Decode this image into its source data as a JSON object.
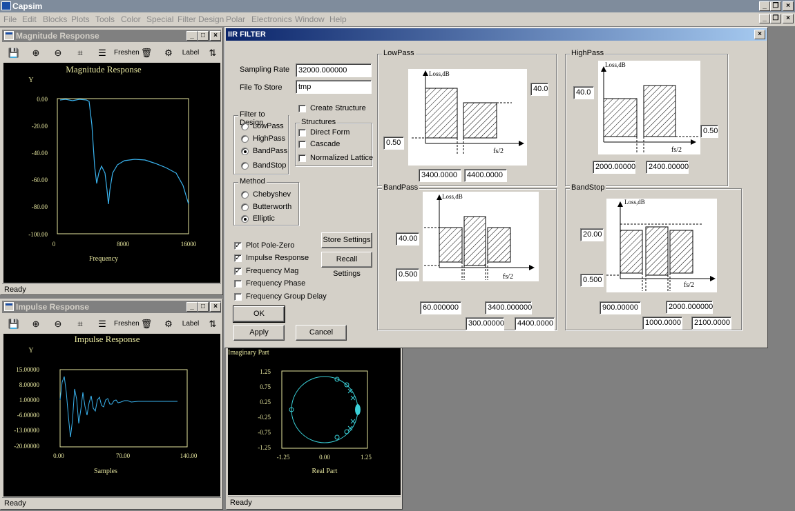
{
  "app": {
    "title": "Capsim"
  },
  "menu": [
    "File",
    "Edit",
    "Blocks",
    "Plots",
    "Tools",
    "Color",
    "Special",
    "Filter Design",
    "Polar",
    "Electronics",
    "Window",
    "Help"
  ],
  "toolbar": {
    "label_btn": "Label",
    "freshen": "Freshen"
  },
  "mag_window": {
    "title": "Magnitude Response",
    "plot_title": "Magnitude Response",
    "ylabel": "Y",
    "xlabel": "Frequency",
    "status": "Ready",
    "yticks": [
      "0.00",
      "-20.00",
      "-40.00",
      "-60.00",
      "-80.00",
      "-100.00"
    ],
    "xticks": [
      "0",
      "8000",
      "16000"
    ]
  },
  "imp_window": {
    "title": "Impulse Response",
    "plot_title": "Impulse Response",
    "ylabel": "Y",
    "xlabel": "Samples",
    "status": "Ready",
    "yticks": [
      "15.00000",
      "8.00000",
      "1.00000",
      "-6.00000",
      "-13.00000",
      "-20.00000"
    ],
    "xticks": [
      "0.00",
      "70.00",
      "140.00"
    ]
  },
  "pz_window": {
    "ylabel": "Imaginary Part",
    "xlabel": "Real Part",
    "status": "Ready",
    "yticks": [
      "1.25",
      "0.75",
      "0.25",
      "-0.25",
      "-0.75",
      "-1.25"
    ],
    "xticks": [
      "-1.25",
      "0.00",
      "1.25"
    ]
  },
  "dialog": {
    "title": "IIR FILTER",
    "sampling_rate_label": "Sampling Rate",
    "sampling_rate_value": "32000.000000",
    "file_label": "File To Store",
    "file_value": "tmp",
    "create_structure": "Create Structure",
    "filter_group": "Filter to Design",
    "filters": [
      "LowPass",
      "HighPass",
      "BandPass",
      "BandStop"
    ],
    "filter_selected": "BandPass",
    "structures_group": "Structures",
    "structures": [
      "Direct Form",
      "Cascade",
      "Normalized Lattice"
    ],
    "method_group": "Method",
    "methods": [
      "Chebyshev",
      "Butterworth",
      "Elliptic"
    ],
    "method_selected": "Elliptic",
    "plots": [
      {
        "label": "Plot Pole-Zero",
        "checked": true
      },
      {
        "label": "Impulse Response",
        "checked": true
      },
      {
        "label": "Frequency Mag",
        "checked": true
      },
      {
        "label": "Frequency Phase",
        "checked": false
      },
      {
        "label": "Frequency Group Delay",
        "checked": false
      }
    ],
    "store_settings": "Store Settings",
    "recall_settings": "Recall Settings",
    "ok": "OK",
    "apply": "Apply",
    "cancel": "Cancel",
    "loss_label": "Loss,dB",
    "fs_label": "fs/2",
    "lowpass": {
      "title": "LowPass",
      "atten": "40.0",
      "ripple": "0.50",
      "f1": "3400.0000",
      "f2": "4400.0000"
    },
    "highpass": {
      "title": "HighPass",
      "atten": "40.0",
      "ripple": "0.50",
      "f1": "2000.00000",
      "f2": "2400.00000"
    },
    "bandpass": {
      "title": "BandPass",
      "atten": "40.00",
      "ripple": "0.500",
      "f1": "60.000000",
      "f2": "300.00000",
      "f3": "3400.000000",
      "f4": "4400.0000"
    },
    "bandstop": {
      "title": "BandStop",
      "atten": "20.00",
      "ripple": "0.500",
      "f1": "900.00000",
      "f2": "1000.0000",
      "f3": "2000.000000",
      "f4": "2100.0000"
    }
  }
}
